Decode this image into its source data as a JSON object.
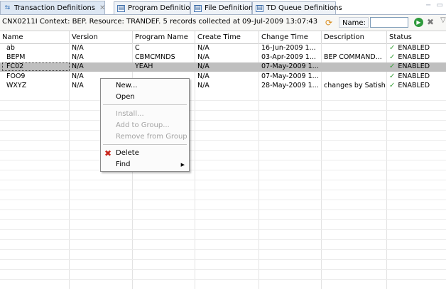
{
  "tabs": [
    {
      "label": "Transaction Definitions",
      "icon": "transaction-icon",
      "active": true,
      "closable": true
    },
    {
      "label": "Program Definitions",
      "icon": "program-icon",
      "active": false
    },
    {
      "label": "File Definitions",
      "icon": "file-icon",
      "active": false
    },
    {
      "label": "TD Queue Definitions",
      "icon": "queue-icon",
      "active": false
    }
  ],
  "context_text": "CNX0211I Context: BEP. Resource: TRANDEF. 5 records collected at 09-Jul-2009 13:07:43",
  "filter": {
    "name_label": "Name:",
    "name_value": ""
  },
  "columns": [
    "Name",
    "Version",
    "Program Name",
    "Create Time",
    "Change Time",
    "Description",
    "Status"
  ],
  "rows": [
    {
      "name": "ab",
      "version": "N/A",
      "program": "C",
      "create": "N/A",
      "change": "16-Jun-2009 1...",
      "description": "",
      "status": "ENABLED"
    },
    {
      "name": "BEPM",
      "version": "N/A",
      "program": "CBMCMNDS",
      "create": "N/A",
      "change": "03-Apr-2009 1...",
      "description": "BEP COMMAND...",
      "status": "ENABLED"
    },
    {
      "name": "FC02",
      "version": "N/A",
      "program": "YEAH",
      "create": "N/A",
      "change": "07-May-2009 1...",
      "description": "",
      "status": "ENABLED",
      "selected": true
    },
    {
      "name": "FOO9",
      "version": "N/A",
      "program": "",
      "create": "N/A",
      "change": "07-May-2009 1...",
      "description": "",
      "status": "ENABLED"
    },
    {
      "name": "WXYZ",
      "version": "N/A",
      "program": "",
      "create": "N/A",
      "change": "28-May-2009 1...",
      "description": "changes by Satish",
      "status": "ENABLED"
    }
  ],
  "menu": {
    "new": "New...",
    "open": "Open",
    "install": "Install...",
    "add_to_group": "Add to Group...",
    "remove_from_group": "Remove from Group",
    "delete": "Delete",
    "find": "Find"
  },
  "colors": {
    "selected_row": "#bfbfbf",
    "status_check": "#3aa13a",
    "delete_icon": "#c8241a"
  }
}
